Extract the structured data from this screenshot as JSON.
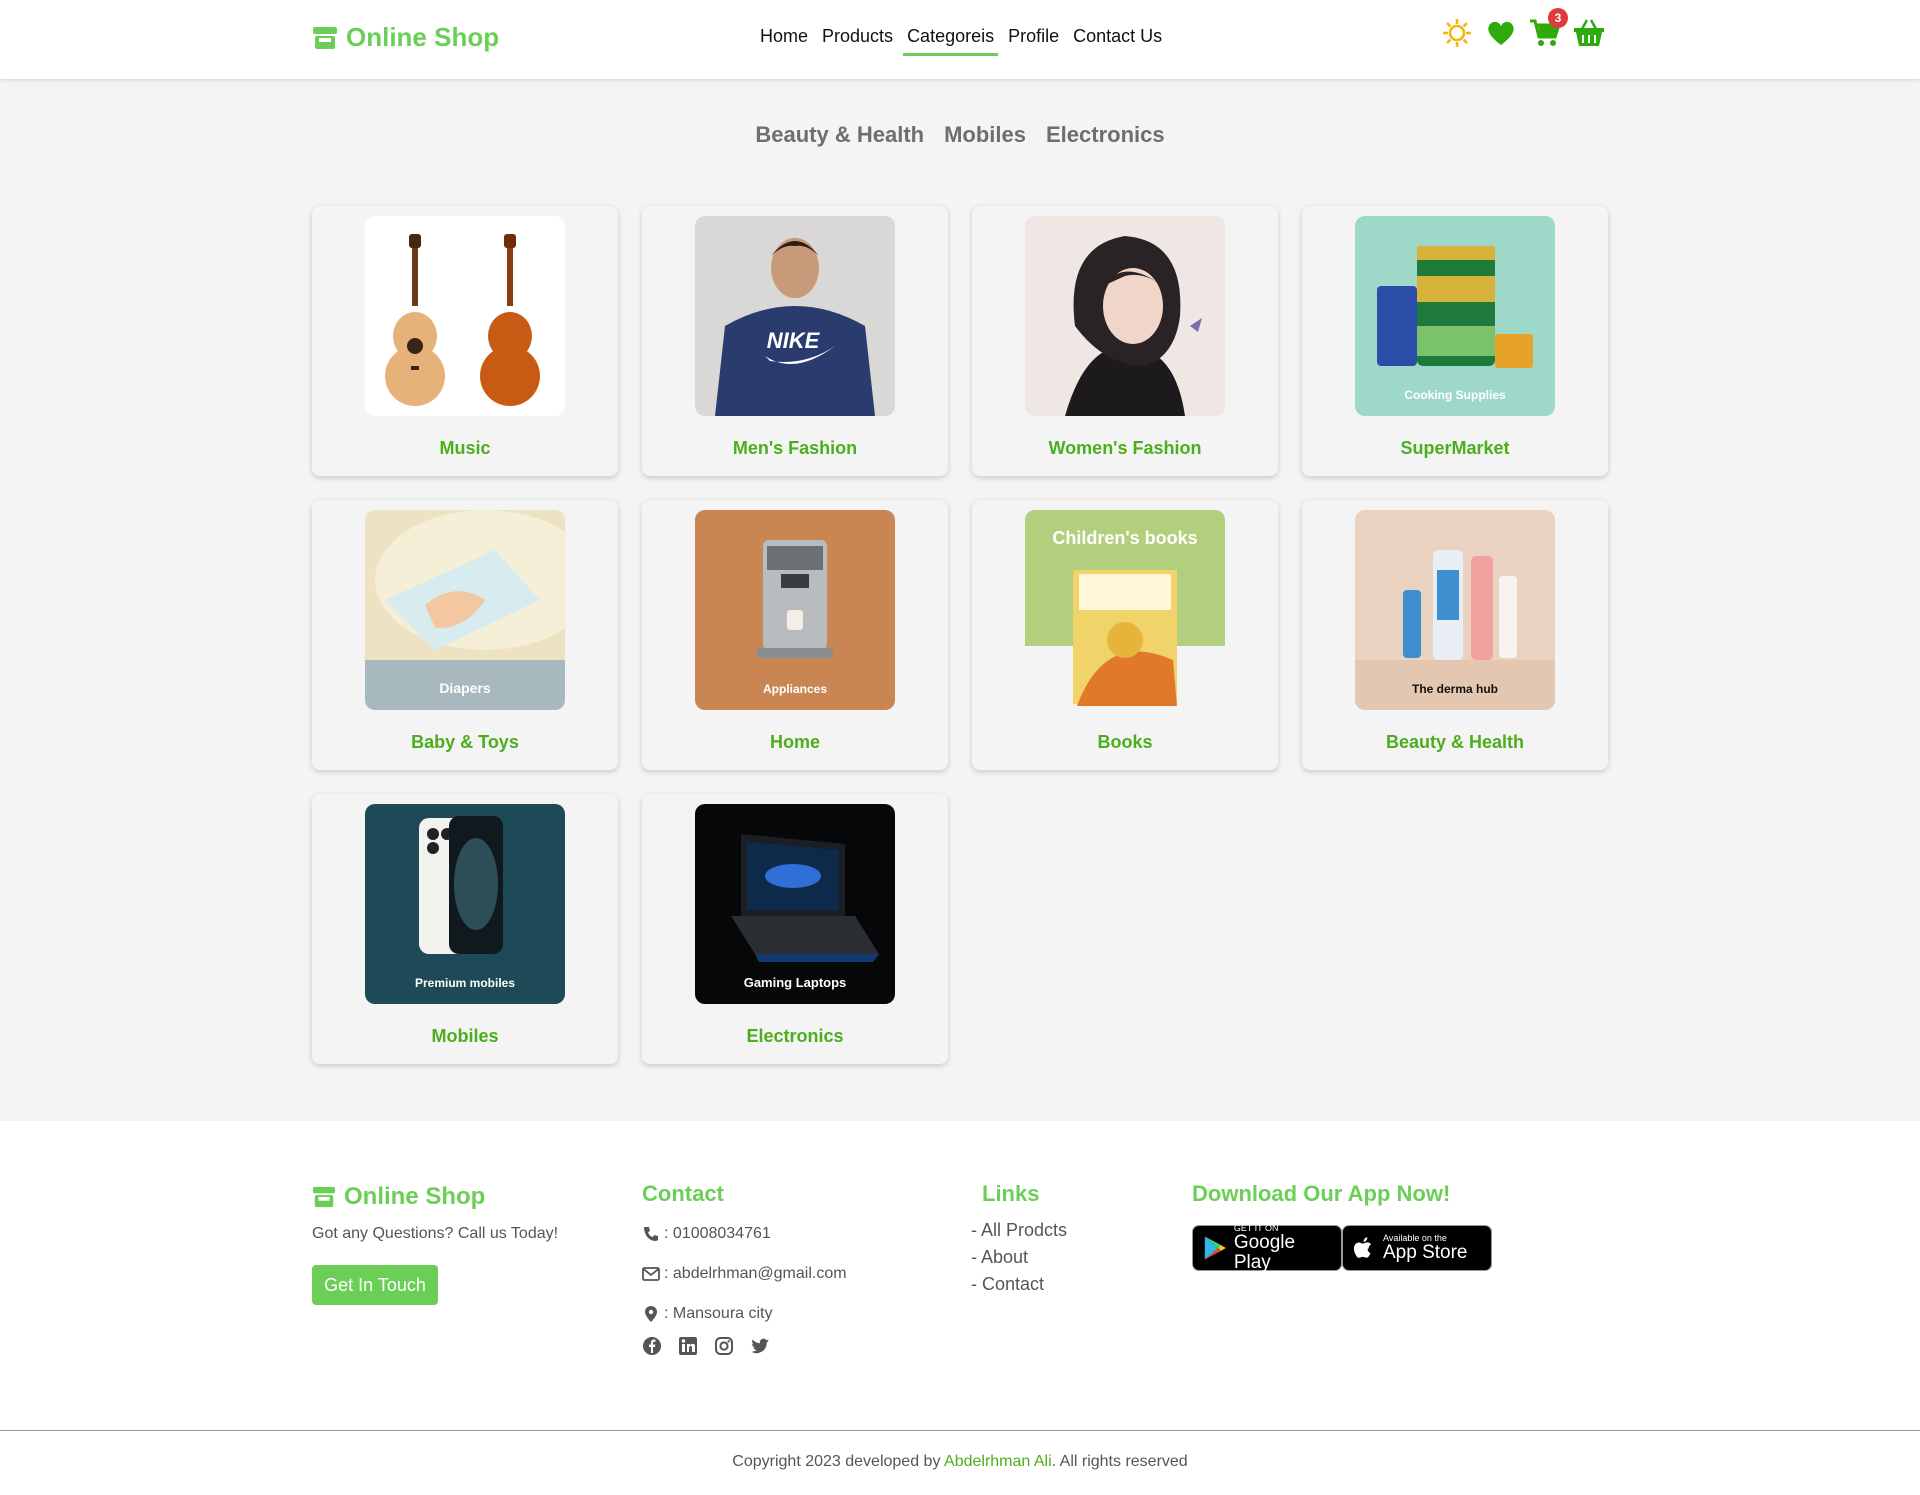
{
  "header": {
    "logo_text": "Online Shop",
    "nav": [
      {
        "label": "Home"
      },
      {
        "label": "Products"
      },
      {
        "label": "Categoreis",
        "active": true
      },
      {
        "label": "Profile"
      },
      {
        "label": "Contact Us"
      }
    ],
    "cart_count": "3",
    "colors": {
      "brand": "#6bcf57",
      "accent_green": "#4cae1c",
      "badge": "#e03a3a",
      "sun": "#f2b705"
    }
  },
  "category_tabs": [
    "Beauty & Health",
    "Mobiles",
    "Electronics"
  ],
  "categories": [
    {
      "title": "Music",
      "image_caption": ""
    },
    {
      "title": "Men's Fashion",
      "image_caption": ""
    },
    {
      "title": "Women's Fashion",
      "image_caption": ""
    },
    {
      "title": "SuperMarket",
      "image_caption": "Cooking Supplies"
    },
    {
      "title": "Baby & Toys",
      "image_caption": "Diapers"
    },
    {
      "title": "Home",
      "image_caption": "Appliances"
    },
    {
      "title": "Books",
      "image_caption": "Children's books"
    },
    {
      "title": "Beauty & Health",
      "image_caption": "The derma hub"
    },
    {
      "title": "Mobiles",
      "image_caption": "Premium mobiles"
    },
    {
      "title": "Electronics",
      "image_caption": "Gaming Laptops"
    }
  ],
  "footer": {
    "logo_text": "Online Shop",
    "tagline": "Got any Questions? Call us Today!",
    "cta": "Get In Touch",
    "contact_heading": "Contact",
    "phone": ": 01008034761",
    "email": ": abdelrhman@gmail.com",
    "location": ": Mansoura city",
    "links_heading": "Links",
    "links": [
      "- All Prodcts",
      "- About",
      "- Contact"
    ],
    "app_heading": "Download Our App Now!",
    "google_play": {
      "small": "GET IT ON",
      "big": "Google Play"
    },
    "app_store": {
      "small": "Available on the",
      "big": "App Store"
    },
    "copyright_prefix": "Copyright 2023 developed by ",
    "copyright_author": "Abdelrhman Ali",
    "copyright_suffix": ". All rights reserved"
  }
}
